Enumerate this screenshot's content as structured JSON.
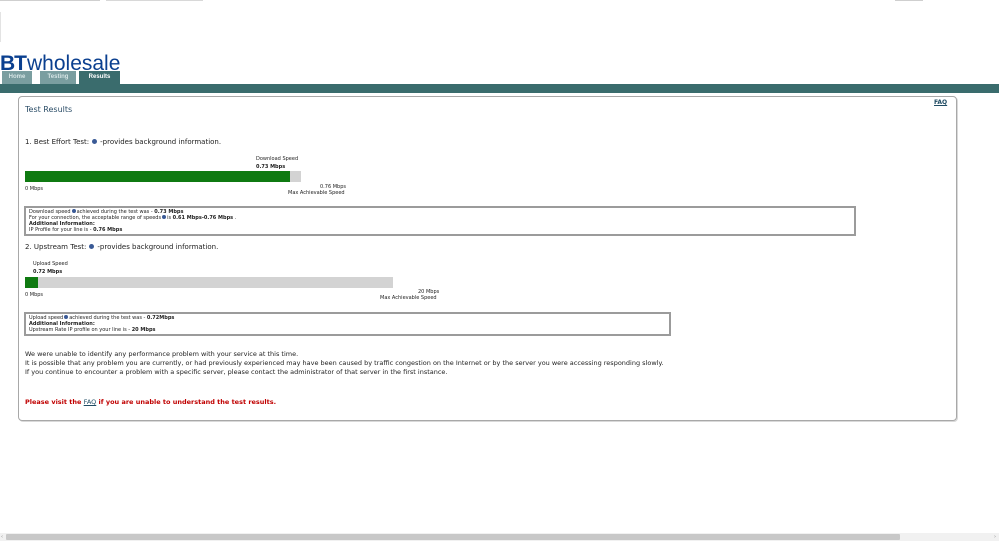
{
  "brand": {
    "bt": "BT",
    "wholesale": "wholesale",
    "color": "#0a3f8f"
  },
  "tabs": [
    {
      "label": "Home",
      "active": false
    },
    {
      "label": "Testing",
      "active": false
    },
    {
      "label": "Results",
      "active": true
    }
  ],
  "colors": {
    "nav": "#3a6c6d",
    "progress_fill": "#0f7a11",
    "progress_track": "#d3d3d3",
    "alert": "#c00000"
  },
  "header": {
    "faq": "FAQ",
    "title": "Test Results"
  },
  "download": {
    "heading_prefix": "1. Best Effort Test:",
    "heading_suffix": "-provides background information.",
    "speed_label": "Download Speed",
    "speed_value": "0.73 Mbps",
    "min_label": "0 Mbps",
    "max_value": "0.76 Mbps",
    "max_label": "Max Achievable Speed",
    "progress_fraction": 0.96,
    "info": {
      "line1_a": "Download speed",
      "line1_b": "achieved during the test was - ",
      "line1_val": "0.73 Mbps",
      "line2_a": "For your connection, the acceptable range of speeds",
      "line2_b": "is ",
      "line2_val": "0.61 Mbps-0.76 Mbps",
      "line2_end": " .",
      "line3": "Additional Information:",
      "line4_a": "IP Profile for your line is - ",
      "line4_val": "0.76 Mbps"
    }
  },
  "upload": {
    "heading_prefix": "2. Upstream Test:",
    "heading_suffix": "-provides background information.",
    "speed_label": "Upload Speed",
    "speed_value": "0.72 Mbps",
    "min_label": "0 Mbps",
    "max_value": "20 Mbps",
    "max_label": "Max Achievable Speed",
    "progress_fraction": 0.036,
    "info": {
      "line1_a": "Upload speed",
      "line1_b": "achieved during the test was - ",
      "line1_val": "0.72Mbps",
      "line2": "Additional Information:",
      "line3_a": "Upstream Rate IP profile on your line is - ",
      "line3_val": "20 Mbps"
    }
  },
  "message": {
    "line1": "We were unable to identify any performance problem with your service at this time.",
    "line2": "It is possible that any problem you are currently, or had previously experienced may have been caused by traffic congestion on the Internet or by the server you were accessing responding slowly.",
    "line3": "If you continue to encounter a problem with a specific server, please contact the administrator of that server in the first instance."
  },
  "help": {
    "prefix": "Please visit the ",
    "link": "FAQ",
    "suffix": " if you are unable to understand the test results."
  },
  "icons": {
    "info": "info-icon"
  }
}
